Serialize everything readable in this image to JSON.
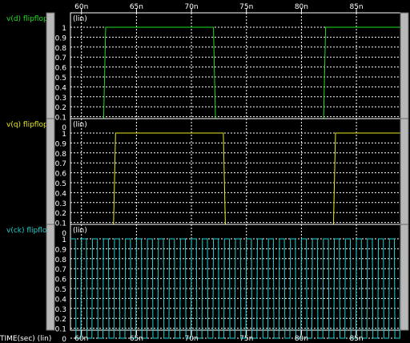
{
  "x_axis": {
    "label": "TIME(sec) (lin)",
    "ticks": [
      "60n",
      "65n",
      "70n",
      "75n",
      "80n",
      "85n"
    ],
    "unit": "ns",
    "range": [
      59,
      89
    ]
  },
  "colors": {
    "background": "#000000",
    "grid": "#ffffff",
    "scrollbar": "#b8b8b8",
    "scrollbar_dark": "#6a6a6a",
    "tick_text": "#ffffff",
    "d": "#22dd22",
    "q": "#e8e820",
    "ck": "#20d0d0"
  },
  "panels": [
    {
      "name": "v(d) flipflop",
      "label": "v(d) flipflop",
      "scale": "(lin)",
      "color": "#22dd22",
      "y_ticks": [
        "1",
        "0.9",
        "0.8",
        "0.7",
        "0.6",
        "0.5",
        "0.4",
        "0.3",
        "0.2",
        "0.1",
        "0"
      ]
    },
    {
      "name": "v(q) flipflop",
      "label": "v(q) flipflop",
      "scale": "(lin)",
      "color": "#e8e820",
      "y_ticks": [
        "1",
        "0.9",
        "0.8",
        "0.7",
        "0.6",
        "0.5",
        "0.4",
        "0.3",
        "0.2",
        "0.1",
        "0"
      ]
    },
    {
      "name": "v(ck) flipflop",
      "label": "v(ck) flipflop",
      "scale": "(lin)",
      "color": "#20d0d0",
      "y_ticks": [
        "1",
        "0.9",
        "0.8",
        "0.7",
        "0.6",
        "0.5",
        "0.4",
        "0.3",
        "0.2",
        "0.1",
        "0"
      ]
    }
  ],
  "chart_data": [
    {
      "type": "line",
      "series": [
        {
          "name": "v(d) flipflop",
          "x": [
            59,
            62,
            62.2,
            72,
            72.2,
            82,
            82.2,
            89
          ],
          "y": [
            0,
            0,
            1,
            1,
            0,
            0,
            1,
            1
          ]
        }
      ],
      "xlabel": "TIME(sec) (lin)",
      "xlim": [
        59,
        89
      ],
      "ylim": [
        0,
        1
      ]
    },
    {
      "type": "line",
      "series": [
        {
          "name": "v(q) flipflop",
          "x": [
            59,
            62.9,
            63.1,
            72.9,
            73.1,
            82.9,
            83.1,
            89
          ],
          "y": [
            0,
            0,
            1,
            1,
            0,
            0,
            1,
            1
          ]
        }
      ],
      "xlabel": "TIME(sec) (lin)",
      "xlim": [
        59,
        89
      ],
      "ylim": [
        0,
        1
      ]
    },
    {
      "type": "line",
      "series": [
        {
          "name": "v(ck) flipflop",
          "x": [
            59,
            59.45,
            59.5,
            59.95,
            60,
            60.45,
            60.5,
            60.95,
            61,
            61.45,
            61.5,
            61.95,
            62,
            62.45,
            62.5,
            62.95,
            63,
            63.45,
            63.5,
            63.95,
            64,
            64.45,
            64.5,
            64.95,
            65,
            65.45,
            65.5,
            65.95,
            66,
            66.45,
            66.5,
            66.95,
            67,
            67.45,
            67.5,
            67.95,
            68,
            68.45,
            68.5,
            68.95,
            69,
            69.45,
            69.5,
            69.95,
            70,
            70.45,
            70.5,
            70.95,
            71,
            71.45,
            71.5,
            71.95,
            72,
            72.45,
            72.5,
            72.95,
            73,
            73.45,
            73.5,
            73.95,
            74,
            74.45,
            74.5,
            74.95,
            75,
            75.45,
            75.5,
            75.95,
            76,
            76.45,
            76.5,
            76.95,
            77,
            77.45,
            77.5,
            77.95,
            78,
            78.45,
            78.5,
            78.95,
            79,
            79.45,
            79.5,
            79.95,
            80,
            80.45,
            80.5,
            80.95,
            81,
            81.45,
            81.5,
            81.95,
            82,
            82.45,
            82.5,
            82.95,
            83,
            83.45,
            83.5,
            83.95,
            84,
            84.45,
            84.5,
            84.95,
            85,
            85.45,
            85.5,
            85.95,
            86,
            86.45,
            86.5,
            86.95,
            87,
            87.45,
            87.5,
            87.95,
            88,
            88.45,
            88.5,
            88.95,
            89
          ],
          "y": [
            1,
            1,
            0,
            0,
            1,
            1,
            0,
            0,
            1,
            1,
            0,
            0,
            1,
            1,
            0,
            0,
            1,
            1,
            0,
            0,
            1,
            1,
            0,
            0,
            1,
            1,
            0,
            0,
            1,
            1,
            0,
            0,
            1,
            1,
            0,
            0,
            1,
            1,
            0,
            0,
            1,
            1,
            0,
            0,
            1,
            1,
            0,
            0,
            1,
            1,
            0,
            0,
            1,
            1,
            0,
            0,
            1,
            1,
            0,
            0,
            1,
            1,
            0,
            0,
            1,
            1,
            0,
            0,
            1,
            1,
            0,
            0,
            1,
            1,
            0,
            0,
            1,
            1,
            0,
            0,
            1,
            1,
            0,
            0,
            1,
            1,
            0,
            0,
            1,
            1,
            0,
            0,
            1,
            1,
            0,
            0,
            1,
            1,
            0,
            0,
            1,
            1,
            0,
            0,
            1,
            1,
            0,
            0,
            1,
            1,
            0,
            0,
            1,
            1,
            0,
            0,
            1,
            1,
            0,
            0,
            1
          ]
        }
      ],
      "xlabel": "TIME(sec) (lin)",
      "xlim": [
        59,
        89
      ],
      "ylim": [
        0,
        1
      ]
    }
  ]
}
